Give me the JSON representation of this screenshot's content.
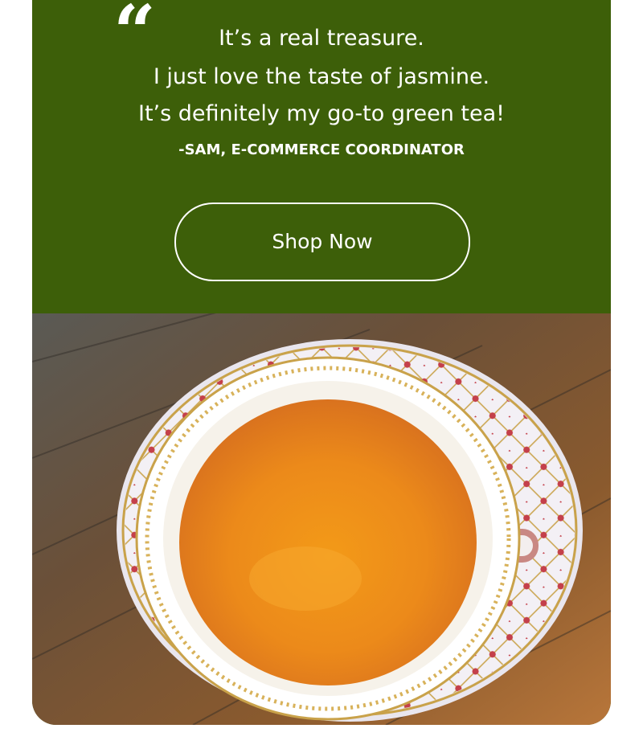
{
  "testimonial": {
    "quote_lines": [
      "It’s a real treasure.",
      "I just love the taste of jasmine.",
      "It’s definitely my go-to green tea!"
    ],
    "attribution": "-SAM, E-COMMERCE COORDINATOR"
  },
  "cta": {
    "label": "Shop Now"
  },
  "colors": {
    "brand_green": "#3d5f09",
    "text": "#ffffff"
  },
  "icons": {
    "quote": "open-quote-icon"
  }
}
